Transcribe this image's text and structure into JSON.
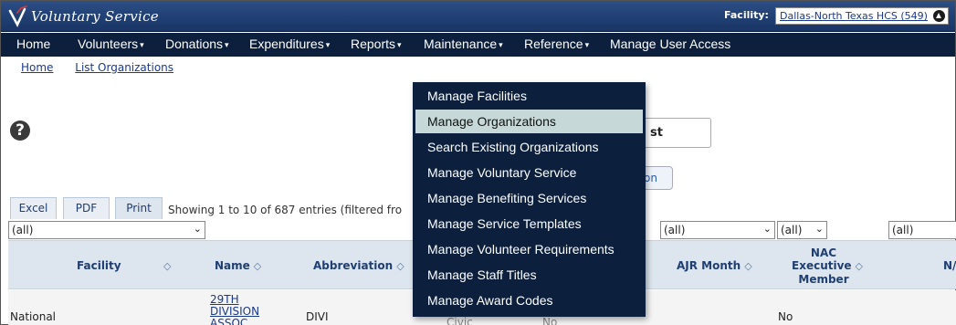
{
  "app": {
    "title": "Voluntary Service",
    "facility_label": "Facility:",
    "facility_value": "Dallas-North Texas HCS (549)"
  },
  "nav": {
    "items": [
      {
        "label": "Home",
        "caret": false
      },
      {
        "label": "Volunteers",
        "caret": true
      },
      {
        "label": "Donations",
        "caret": true
      },
      {
        "label": "Expenditures",
        "caret": true
      },
      {
        "label": "Reports",
        "caret": true
      },
      {
        "label": "Maintenance",
        "caret": true
      },
      {
        "label": "Reference",
        "caret": true
      },
      {
        "label": "Manage User Access",
        "caret": false
      }
    ]
  },
  "breadcrumb": {
    "home": "Home",
    "current": "List Organizations"
  },
  "maintenance_menu": {
    "items": [
      "Manage Facilities",
      "Manage Organizations",
      "Search Existing Organizations",
      "Manage Voluntary Service",
      "Manage Benefiting Services",
      "Manage Service Templates",
      "Manage Volunteer Requirements",
      "Manage Staff Titles",
      "Manage Award Codes"
    ],
    "active_index": 1
  },
  "partial_controls": {
    "button_text": "st",
    "button2_text": "on"
  },
  "table": {
    "export_buttons": [
      "Excel",
      "PDF",
      "Print"
    ],
    "showing_text": "Showing 1 to 10 of 687 entries (filtered fro",
    "filters": {
      "facility": "(all)",
      "ajr_month": "(all)",
      "nac_exec": "(all)",
      "last": "(all)"
    },
    "headers": {
      "facility": "Facility",
      "name": "Name",
      "abbreviation": "Abbreviation",
      "ajr_month": "AJR Month",
      "nac_exec_line1": "NAC",
      "nac_exec_line2": "Executive",
      "nac_exec_line3": "Member",
      "last": "N/"
    },
    "sort_glyph": "◇",
    "rows": [
      {
        "facility": "National",
        "name_line1": "29TH",
        "name_line2": "DIVISION",
        "name_line3": "ASSOC",
        "abbreviation": "DIVI",
        "type_partial": "Civic",
        "flag_partial": "No",
        "nac_exec": "No"
      }
    ]
  }
}
